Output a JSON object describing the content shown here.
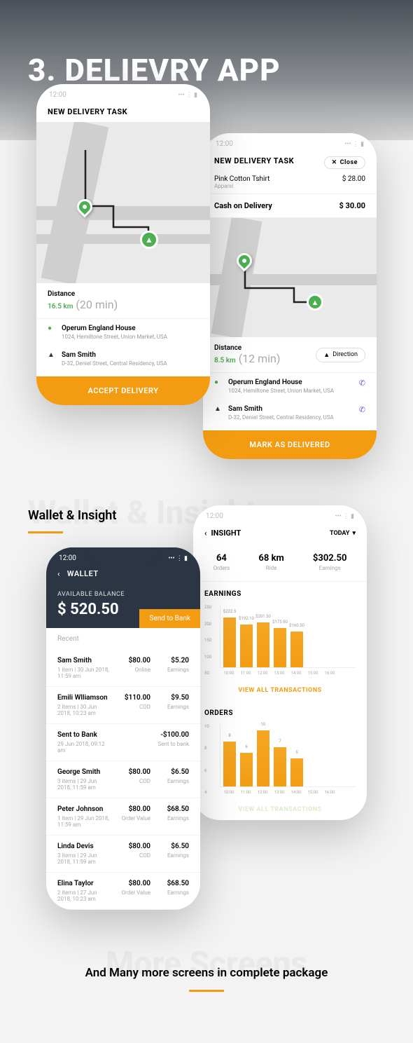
{
  "hero": {
    "title": "3. DELIEVRY APP"
  },
  "phone1": {
    "time": "12:00",
    "header": "NEW DELIVERY TASK",
    "distance_label": "Distance",
    "distance_value": "16.5 km",
    "distance_time": "(20 min)",
    "pickup_name": "Operum England House",
    "pickup_addr": "1024, Hemiltone Street, Union Market, USA",
    "drop_name": "Sam Smith",
    "drop_addr": "D-32, Deniel Street, Central Residency, USA",
    "button": "ACCEPT DELIVERY"
  },
  "phone2": {
    "time": "12:00",
    "header": "NEW DELIVERY TASK",
    "close": "Close",
    "item_name": "Pink Cotton Tshirt",
    "item_cat": "Apparel",
    "item_price": "$ 28.00",
    "cod_label": "Cash on Delivery",
    "cod_value": "$ 30.00",
    "distance_label": "Distance",
    "distance_value": "8.5 km",
    "distance_time": "(12 min)",
    "direction": "Direction",
    "pickup_name": "Operum England House",
    "pickup_addr": "1024, Hemiltone Street, Union Market, USA",
    "drop_name": "Sam Smith",
    "drop_addr": "D-32, Deniel Street, Central Residency, USA",
    "button": "MARK AS DELIVERED"
  },
  "section1": {
    "bg": "Wallet & Insight",
    "title": "Wallet & Insight"
  },
  "phone3": {
    "time": "12:00",
    "title": "WALLET",
    "balance_label": "AVAILABLE BALANCE",
    "balance": "$ 520.50",
    "send": "Send to Bank",
    "recent": "Recent",
    "txs": [
      {
        "name": "Sam Smith",
        "meta": "1 item | 30 Jun 2018, 11:59 am",
        "mid": "$80.00",
        "mid_sub": "Online",
        "right": "$5.20",
        "right_sub": "Earnings"
      },
      {
        "name": "Emili Wlliamson",
        "meta": "2 items | 30 Jun 2018, 10:23 am",
        "mid": "$110.00",
        "mid_sub": "COD",
        "right": "$9.50",
        "right_sub": "Earnings"
      },
      {
        "name": "Sent to Bank",
        "meta": "29 Jun 2018, 09:12 am",
        "mid": "",
        "mid_sub": "",
        "right": "-$100.00",
        "right_sub": "Sent to bank"
      },
      {
        "name": "George Smith",
        "meta": "3 items | 29 Jun 2018, 11:59 am",
        "mid": "$80.00",
        "mid_sub": "COD",
        "right": "$6.50",
        "right_sub": "Earnings"
      },
      {
        "name": "Peter Johnson",
        "meta": "1 item | 29 Jun 2018, 11:59 am",
        "mid": "$80.00",
        "mid_sub": "Order Value",
        "right": "$68.50",
        "right_sub": "Earnings"
      },
      {
        "name": "Linda Devis",
        "meta": "3 items | 29 Jun 2018, 11:59 am",
        "mid": "$80.00",
        "mid_sub": "COD",
        "right": "$6.50",
        "right_sub": "Earnings"
      },
      {
        "name": "Elina Taylor",
        "meta": "2 items | 27 Jun 2018, 10:23 am",
        "mid": "$80.00",
        "mid_sub": "Order Value",
        "right": "$68.50",
        "right_sub": "Earnings"
      }
    ]
  },
  "phone4": {
    "time": "12:00",
    "title": "INSIGHT",
    "today": "TODAY",
    "stats": [
      {
        "val": "64",
        "label": "Orders"
      },
      {
        "val": "68 km",
        "label": "Ride"
      },
      {
        "val": "$302.50",
        "label": "Earnings"
      }
    ],
    "earnings_title": "EARNINGS",
    "orders_title": "ORDERS",
    "view_all": "VIEW ALL TRANSACTIONS",
    "view_all2": "VIEW ALL TRANSACTIONS"
  },
  "chart_data": [
    {
      "type": "bar",
      "title": "EARNINGS",
      "categories": [
        "10:00",
        "11:00",
        "12:00",
        "13:00",
        "14:00",
        "15:00",
        "16:00"
      ],
      "values": [
        222.5,
        192.1,
        201.5,
        175.9,
        160.5,
        0,
        0
      ],
      "labels": [
        "$222.5",
        "$192.10",
        "$201.50",
        "$175.90",
        "$160.50",
        "",
        ""
      ],
      "ylim": [
        0,
        250
      ],
      "y_ticks": [
        50,
        100,
        150,
        200,
        250
      ]
    },
    {
      "type": "bar",
      "title": "ORDERS",
      "categories": [
        "10:00",
        "11:00",
        "12:00",
        "13:00",
        "14:00",
        "15:00",
        "16:00"
      ],
      "values": [
        8,
        6,
        10,
        7,
        5,
        0,
        0
      ],
      "labels": [
        "8",
        "6",
        "10",
        "7",
        "5",
        "",
        ""
      ],
      "ylim": [
        0,
        10
      ],
      "y_ticks": [
        4,
        6,
        8,
        10
      ]
    }
  ],
  "footer": {
    "bg": "More Screens",
    "title": "And Many more screens in complete package"
  }
}
